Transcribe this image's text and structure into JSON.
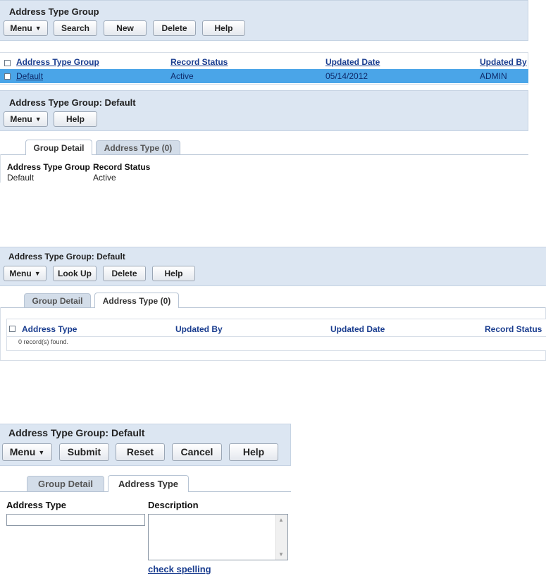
{
  "section1": {
    "title": "Address Type Group",
    "buttons": {
      "menu": "Menu",
      "search": "Search",
      "new": "New",
      "delete": "Delete",
      "help": "Help"
    },
    "grid": {
      "columns": [
        "Address Type Group",
        "Record Status",
        "Updated Date",
        "Updated By"
      ],
      "rows": [
        {
          "group": "Default",
          "status": "Active",
          "date": "05/14/2012",
          "by": "ADMIN"
        }
      ]
    }
  },
  "section2": {
    "title": "Address Type Group: Default",
    "buttons": {
      "menu": "Menu",
      "help": "Help"
    },
    "tabs": [
      "Group Detail",
      "Address Type (0)"
    ],
    "fields": {
      "group_label": "Address Type Group",
      "group_value": "Default",
      "status_label": "Record Status",
      "status_value": "Active"
    }
  },
  "section3": {
    "title": "Address Type Group: Default",
    "buttons": {
      "menu": "Menu",
      "lookup": "Look Up",
      "delete": "Delete",
      "help": "Help"
    },
    "tabs": [
      "Group Detail",
      "Address Type (0)"
    ],
    "grid": {
      "columns": [
        "Address Type",
        "Updated By",
        "Updated Date",
        "Record Status"
      ],
      "empty_message": "0 record(s) found."
    }
  },
  "section4": {
    "title": "Address Type Group: Default",
    "buttons": {
      "menu": "Menu",
      "submit": "Submit",
      "reset": "Reset",
      "cancel": "Cancel",
      "help": "Help"
    },
    "tabs": [
      "Group Detail",
      "Address Type"
    ],
    "form": {
      "address_type_label": "Address Type",
      "address_type_value": "",
      "description_label": "Description",
      "description_value": "",
      "spell_link": "check spelling"
    }
  },
  "colors": {
    "header_bg": "#dce6f2",
    "selected_row": "#4aa5e8",
    "link": "#1a3d8f"
  },
  "icons": {
    "menu_caret": "chevron-down-icon"
  }
}
